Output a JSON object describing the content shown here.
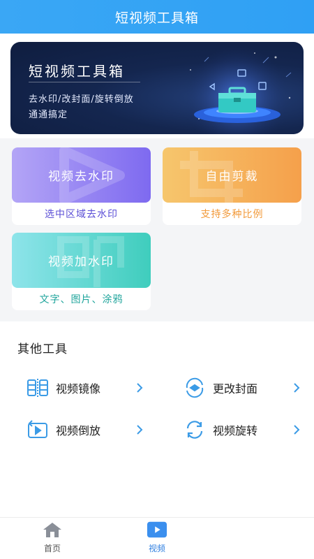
{
  "header": {
    "title": "短视频工具箱"
  },
  "banner": {
    "title": "短视频工具箱",
    "subtitle1": "去水印/改封面/旋转倒放",
    "subtitle2": "通通搞定"
  },
  "cards": [
    {
      "label": "视频去水印",
      "caption": "选中区域去水印",
      "caption_color": "#5b4fd6"
    },
    {
      "label": "自由剪裁",
      "caption": "支持多种比例",
      "caption_color": "#f29a3a"
    },
    {
      "label": "视频加水印",
      "caption": "文字、图片、涂鸦",
      "caption_color": "#20a59c"
    }
  ],
  "tools": {
    "title": "其他工具",
    "items": [
      {
        "label": "视频镜像",
        "icon": "mirror-icon"
      },
      {
        "label": "更改封面",
        "icon": "cover-icon"
      },
      {
        "label": "视频倒放",
        "icon": "reverse-play-icon"
      },
      {
        "label": "视频旋转",
        "icon": "rotate-icon"
      }
    ]
  },
  "tabbar": {
    "items": [
      {
        "label": "首页",
        "icon": "home-icon",
        "active": false
      },
      {
        "label": "视频",
        "icon": "video-icon",
        "active": true
      }
    ]
  },
  "colors": {
    "accent": "#2fa0f4",
    "tab_active": "#2f7fe0",
    "tab_inactive": "#555555",
    "tool_icon": "#3b9be6"
  }
}
